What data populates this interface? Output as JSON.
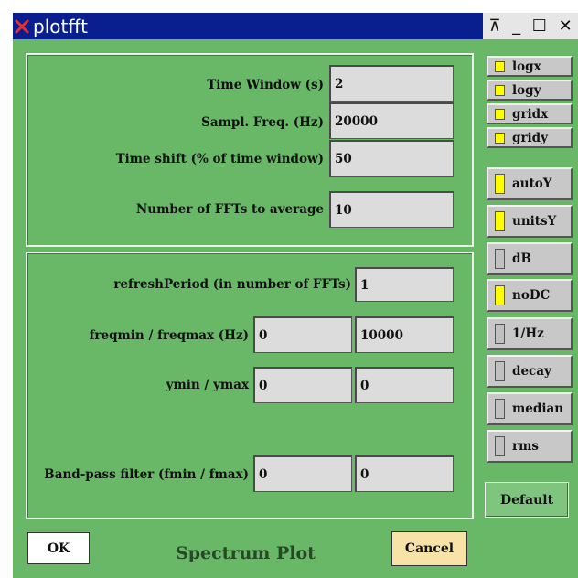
{
  "window": {
    "title": "plotfft",
    "controls": {
      "stick": "⊼",
      "minimize": "_",
      "maximize": "☐",
      "close": "✕"
    }
  },
  "timing": {
    "time_window_label": "Time Window (s)",
    "time_window_value": "2",
    "sampl_freq_label": "Sampl. Freq. (Hz)",
    "sampl_freq_value": "20000",
    "time_shift_label": "Time shift (% of time window)",
    "time_shift_value": "50",
    "n_ffts_label": "Number of FFTs to average",
    "n_ffts_value": "10"
  },
  "plot": {
    "refresh_label": "refreshPeriod (in number of FFTs)",
    "refresh_value": "1",
    "freq_label": "freqmin / freqmax (Hz)",
    "freqmin_value": "0",
    "freqmax_value": "10000",
    "y_label": "ymin / ymax",
    "ymin_value": "0",
    "ymax_value": "0",
    "bandpass_label": "Band-pass filter (fmin / fmax)",
    "fmin_value": "0",
    "fmax_value": "0"
  },
  "toggles": {
    "logx": {
      "label": "logx",
      "on": true
    },
    "logy": {
      "label": "logy",
      "on": true
    },
    "gridx": {
      "label": "gridx",
      "on": true
    },
    "gridy": {
      "label": "gridy",
      "on": true
    },
    "autoY": {
      "label": "autoY",
      "on": true
    },
    "unitsY": {
      "label": "unitsY",
      "on": true
    },
    "dB": {
      "label": "dB",
      "on": false
    },
    "noDC": {
      "label": "noDC",
      "on": true
    },
    "perHz": {
      "label": "1/Hz",
      "on": false
    },
    "decay": {
      "label": "decay",
      "on": false
    },
    "median": {
      "label": "median",
      "on": false
    },
    "rms": {
      "label": "rms",
      "on": false
    }
  },
  "buttons": {
    "default": "Default",
    "ok": "OK",
    "cancel": "Cancel"
  },
  "footer": {
    "caption": "Spectrum Plot"
  },
  "colors": {
    "window_bg": "#68b868",
    "titlebar_bg": "#0a1f8f",
    "indicator_on": "#ffff00",
    "cancel_bg": "#f7e3a8"
  }
}
